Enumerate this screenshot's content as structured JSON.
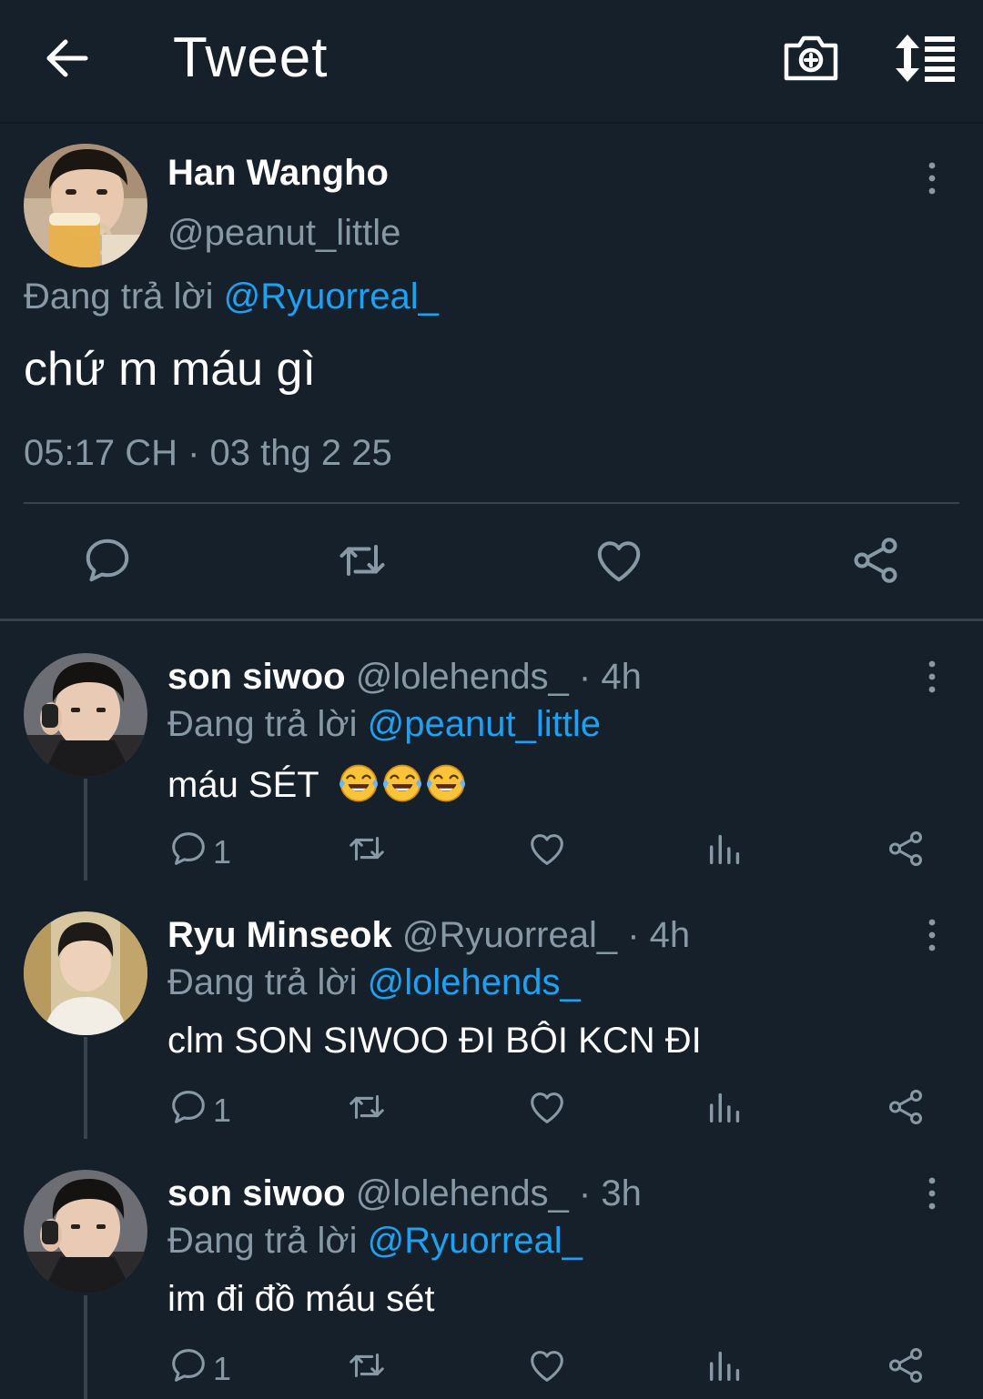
{
  "header": {
    "title": "Tweet"
  },
  "main_tweet": {
    "name": "Han Wangho",
    "handle": "@peanut_little",
    "replying_prefix": "Đang trả lời",
    "replying_to": "@Ryuorreal_",
    "text": "chứ m máu gì",
    "timestamp": "05:17 CH · 03 thg 2 25"
  },
  "replies": [
    {
      "name": "son siwoo",
      "handle_time": "@lolehends_ · 4h",
      "replying_prefix": "Đang trả lời",
      "replying_to": "@peanut_little",
      "text": "máu SÉT",
      "emoji": "rolling-on-floor-laughing x3",
      "reply_count": "1"
    },
    {
      "name": "Ryu Minseok",
      "handle_time": "@Ryuorreal_ · 4h",
      "replying_prefix": "Đang trả lời",
      "replying_to": "@lolehends_",
      "text": "clm SON SIWOO ĐI BÔI KCN ĐI",
      "reply_count": "1"
    },
    {
      "name": "son siwoo",
      "handle_time": "@lolehends_ · 3h",
      "replying_prefix": "Đang trả lời",
      "replying_to": "@Ryuorreal_",
      "text": "im đi đồ máu sét",
      "reply_count": "1"
    }
  ],
  "colors": {
    "background": "#15202b",
    "secondary_text": "#8899a6",
    "link": "#1da1f2",
    "divider": "#38444d"
  }
}
